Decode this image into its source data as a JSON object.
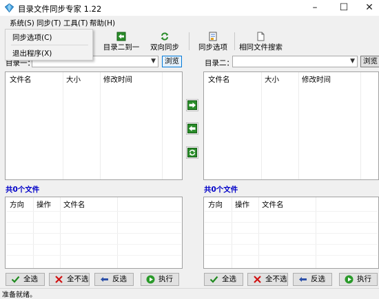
{
  "window": {
    "title": "目录文件同步专家 1.22"
  },
  "menu": [
    "系统(S)",
    "同步(T)",
    "工具(T)",
    "帮助(H)"
  ],
  "dropdown": [
    "同步选项(C)",
    "退出程序(X)"
  ],
  "toolbar": [
    "目录二到一",
    "双向同步",
    "同步选项",
    "相同文件搜索"
  ],
  "dir1": {
    "label": "目录一：",
    "value": "",
    "browse": "浏览"
  },
  "dir2": {
    "label": "目录二：",
    "value": "",
    "browse": "浏览"
  },
  "file_columns": [
    "文件名",
    "大小",
    "修改时间"
  ],
  "task_columns": [
    "方向",
    "操作",
    "文件名"
  ],
  "left_count": "共0个文件",
  "right_count": "共0个文件",
  "buttons": {
    "select_all": "全选",
    "select_none": "全不选",
    "invert": "反选",
    "execute": "执行"
  },
  "status": "准备就绪。"
}
